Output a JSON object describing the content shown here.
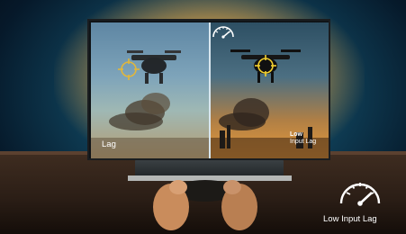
{
  "tv": {
    "left_label": "Lag",
    "right_label_line1": "Low",
    "right_label_line2": "Input Lag"
  },
  "corner": {
    "label": "Low Input Lag",
    "icon": "speedometer-icon"
  },
  "colors": {
    "ambient_glow": "#ffc45a",
    "crosshair_left": "#e2b73a",
    "crosshair_right": "#f3d02f",
    "background": "#0f3f57"
  }
}
